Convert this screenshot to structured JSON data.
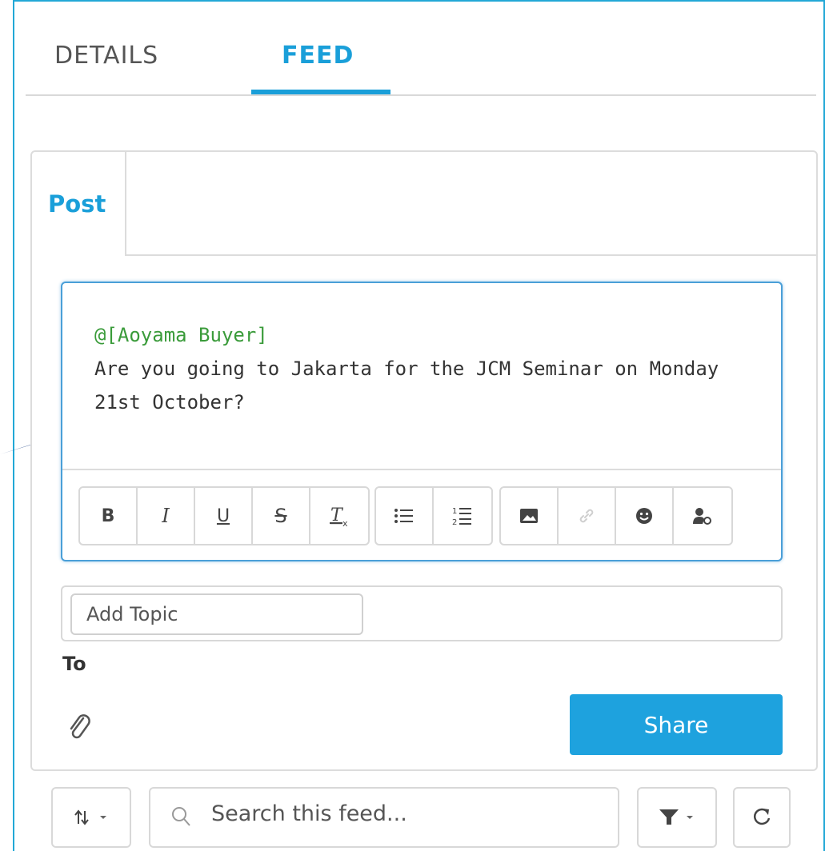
{
  "tabs": {
    "details": "DETAILS",
    "feed": "FEED"
  },
  "publisher": {
    "post_tab": "Post",
    "mention": "@[Aoyama Buyer]",
    "message": "Are you going to Jakarta for the JCM Seminar on Monday 21st October?",
    "toolbar": [
      "bold-icon",
      "italic-icon",
      "underline-icon",
      "strikethrough-icon",
      "clear-format-icon",
      "bulleted-list-icon",
      "numbered-list-icon",
      "image-icon",
      "link-icon",
      "emoji-icon",
      "mention-user-icon"
    ],
    "topic_placeholder": "Add Topic",
    "to_label": "To",
    "share_label": "Share"
  },
  "feed_controls": {
    "search_placeholder": "Search this feed..."
  },
  "colors": {
    "accent": "#1a9fd9",
    "share": "#1ea2de",
    "mention": "#3a9b3a",
    "frame": "#22a8d6"
  }
}
